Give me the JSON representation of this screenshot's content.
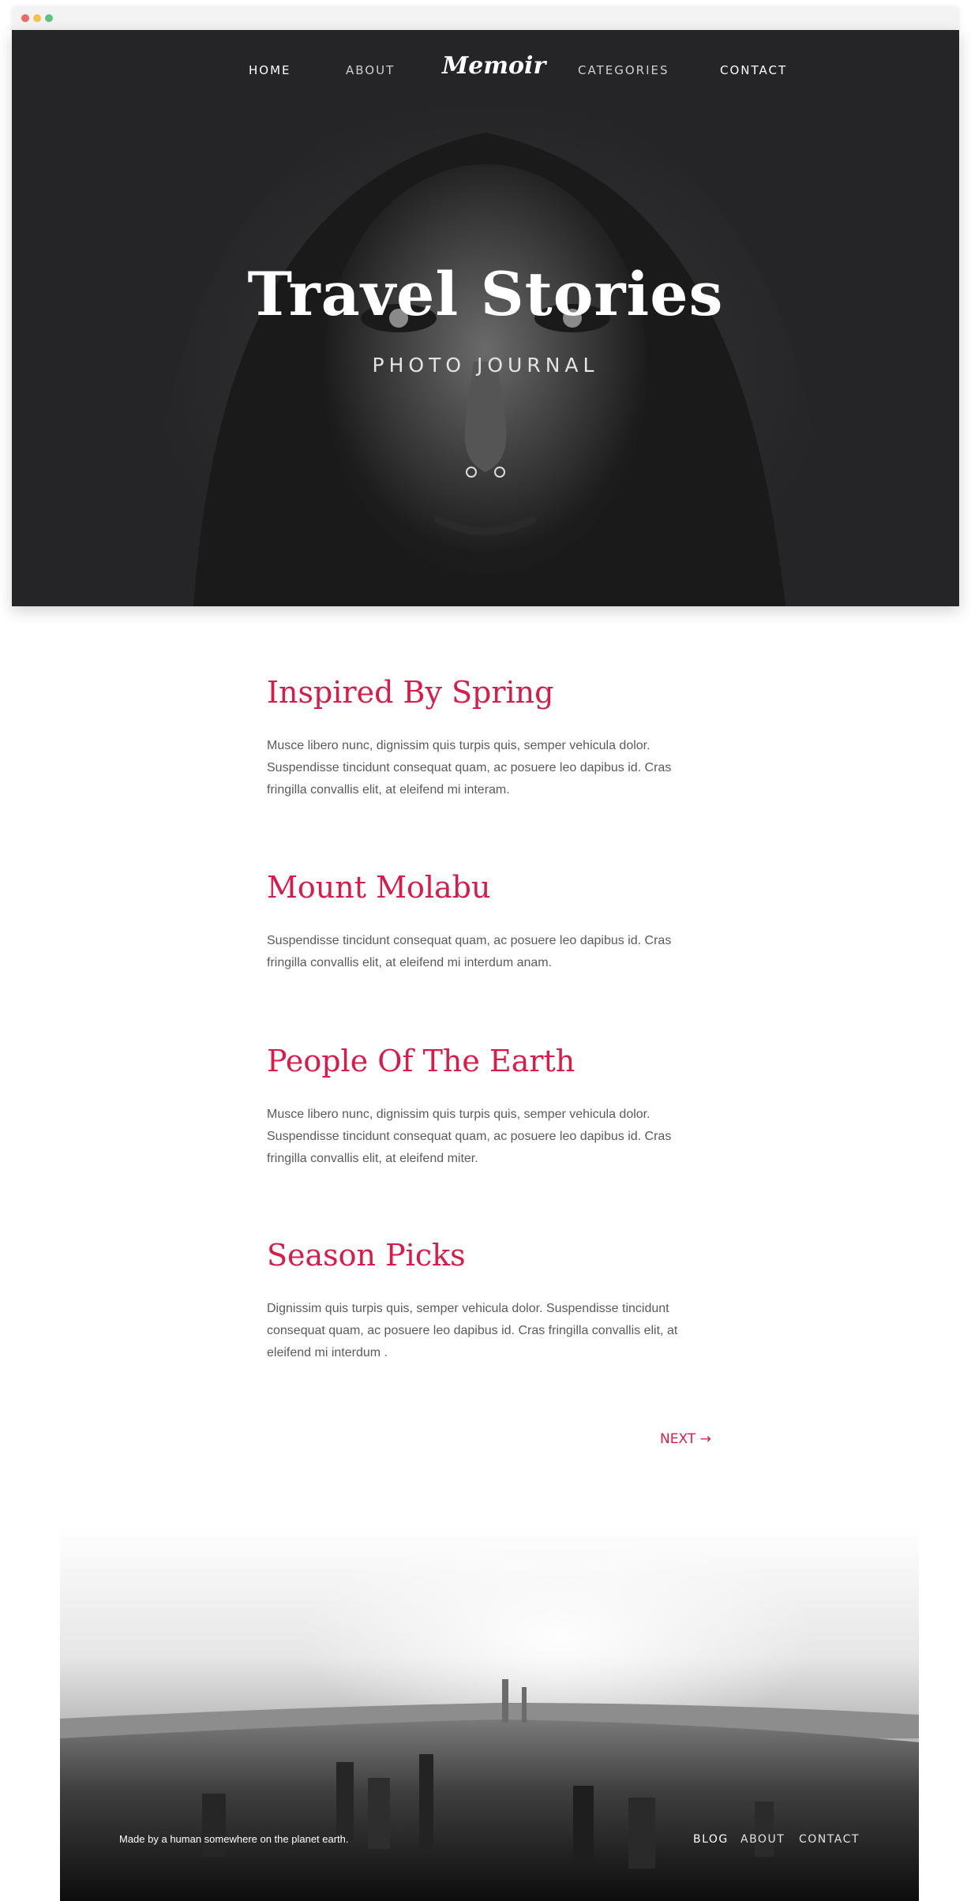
{
  "window": {
    "controls": {
      "close_color": "#ec6b69",
      "minimize_color": "#f2c14e",
      "maximize_color": "#5fc27e"
    }
  },
  "nav": {
    "home": "HOME",
    "about": "ABOUT",
    "logo": "Memoir",
    "categories": "CATEGORIES",
    "contact": "CONTACT"
  },
  "hero": {
    "title": "Travel Stories",
    "subtitle": "PHOTO JOURNAL"
  },
  "articles": [
    {
      "title": "Inspired By Spring",
      "excerpt": "Musce libero nunc, dignissim quis turpis quis, semper vehicula dolor. Suspendisse tincidunt consequat quam, ac posuere leo dapibus id. Cras fringilla convallis elit, at eleifend mi interam."
    },
    {
      "title": "Mount Molabu",
      "excerpt": "Suspendisse tincidunt consequat quam, ac posuere leo dapibus id. Cras fringilla convallis elit, at eleifend mi interdum anam."
    },
    {
      "title": "People Of The Earth",
      "excerpt": "Musce libero nunc, dignissim quis turpis quis, semper vehicula dolor. Suspendisse tincidunt consequat quam, ac posuere leo dapibus id. Cras fringilla convallis elit, at eleifend miter."
    },
    {
      "title": "Season Picks",
      "excerpt": "Dignissim quis turpis quis, semper vehicula dolor. Suspendisse tincidunt consequat quam, ac posuere leo dapibus id. Cras fringilla convallis elit, at eleifend mi interdum ."
    }
  ],
  "pagination": {
    "next": "NEXT →"
  },
  "footer": {
    "credit": "Made by a human somewhere on the planet earth.",
    "links": {
      "blog": "BLOG",
      "about": "ABOUT",
      "contact": "CONTACT"
    }
  },
  "colors": {
    "accent": "#d81b49",
    "body_text": "#5b5b5b",
    "hero_bg": "#252527"
  },
  "icons": {
    "next_arrow": "arrow-right-icon"
  }
}
